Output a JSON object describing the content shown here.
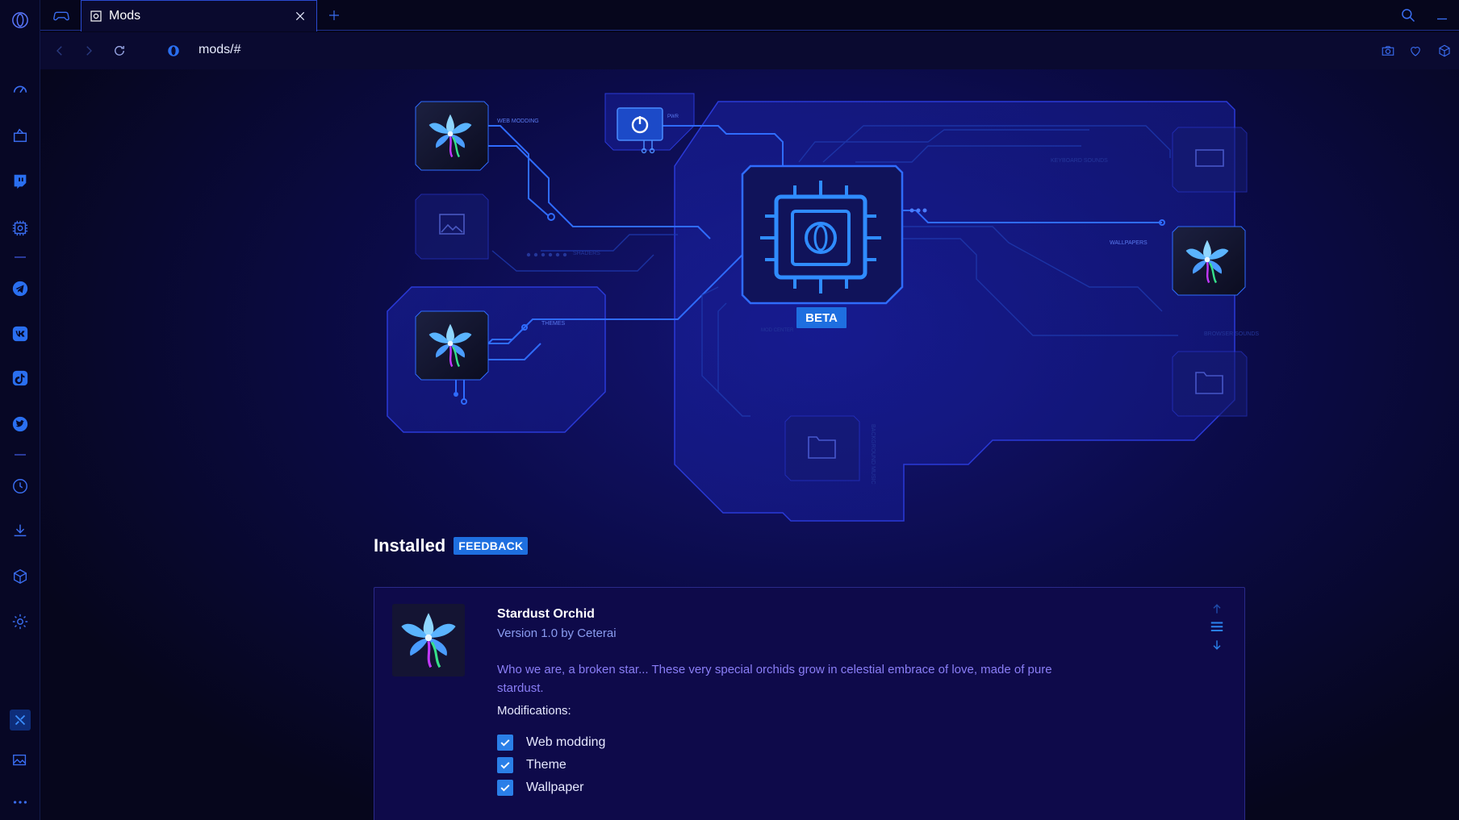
{
  "browser": {
    "tab_title": "Mods",
    "url": "mods/#"
  },
  "sidebar": {
    "items": [
      {
        "icon": "opera-gx-logo-icon"
      },
      {
        "icon": "gx-control-speedometer-icon"
      },
      {
        "icon": "gx-corner-icon"
      },
      {
        "icon": "twitch-icon"
      },
      {
        "icon": "mods-chip-icon"
      },
      {
        "icon": "telegram-icon"
      },
      {
        "icon": "vk-icon"
      },
      {
        "icon": "tiktok-icon"
      },
      {
        "icon": "twitter-icon"
      },
      {
        "icon": "history-clock-icon"
      },
      {
        "icon": "downloads-icon"
      },
      {
        "icon": "extensions-cube-icon"
      },
      {
        "icon": "settings-gear-icon"
      },
      {
        "icon": "player-tools-icon"
      },
      {
        "icon": "wallpaper-gallery-icon"
      },
      {
        "icon": "more-dots-icon"
      }
    ]
  },
  "hero": {
    "beta_label": "BETA",
    "labels": {
      "web_modding": "WEB MODDING",
      "pwr": "PWR",
      "shaders": "SHADERS",
      "themes": "THEMES",
      "wallpapers": "WALLPAPERS",
      "keyboard_sounds": "KEYBOARD SOUNDS",
      "browser_sounds": "BROWSER SOUNDS",
      "mod_center": "MOD CENTER",
      "background_music": "BACKGROUND MUSIC"
    }
  },
  "installed": {
    "title": "Installed",
    "feedback": "FEEDBACK"
  },
  "mod": {
    "name": "Stardust Orchid",
    "version": "Version 1.0 by Ceterai",
    "description": "Who we are, a broken star... These very special orchids grow in celestial embrace of love, made of pure stardust.",
    "modifications_label": "Modifications:",
    "modifications": [
      {
        "label": "Web modding",
        "checked": true
      },
      {
        "label": "Theme",
        "checked": true
      },
      {
        "label": "Wallpaper",
        "checked": true
      }
    ]
  },
  "colors": {
    "accent": "#2a7fe8",
    "circuit": "#2f6cff",
    "background": "#06061c",
    "card": "#0e0a4a",
    "description_text": "#8a7ef6"
  }
}
